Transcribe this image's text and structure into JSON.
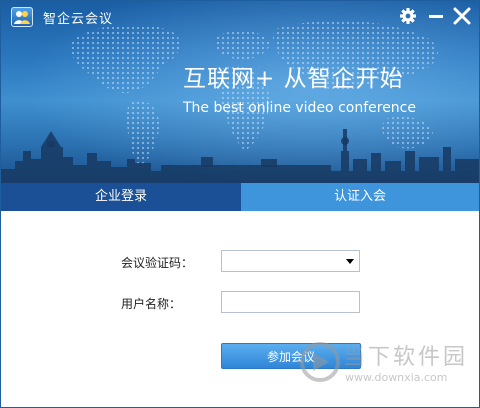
{
  "window": {
    "title": "智企云会议"
  },
  "hero": {
    "slogan": "互联网+ 从智企开始",
    "subslogan": "The best online video conference"
  },
  "tabs": [
    {
      "label": "企业登录"
    },
    {
      "label": "认证入会"
    }
  ],
  "form": {
    "code_label": "会议验证码：",
    "code_value": "",
    "name_label": "用户名称：",
    "name_value": "",
    "join_label": "参加会议"
  },
  "watermark": {
    "brand": "当下软件园",
    "url": "www.downxia.com"
  },
  "icons": {
    "settings": "gear-icon",
    "minimize": "minimize-icon",
    "close": "close-icon",
    "app": "app-logo-icon"
  },
  "colors": {
    "tab_active": "#1b4f96",
    "tab_inactive": "#3e95db",
    "button": "#3a8fde"
  }
}
